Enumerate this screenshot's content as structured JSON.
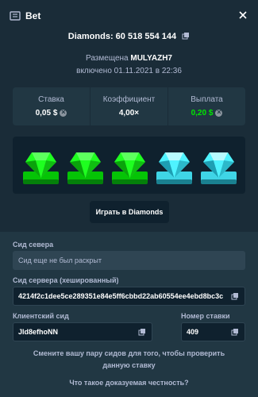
{
  "header": {
    "title": "Bet",
    "icon": "bet-ticket-icon",
    "close_icon": "close-icon"
  },
  "game": {
    "label": "Diamonds: 60 518 554 144",
    "placed_label": "Размещена",
    "user": "MULYAZH7",
    "date": "включено 01.11.2021 в 22:36"
  },
  "stats": {
    "bet_label": "Ставка",
    "bet_value": "0,05 $",
    "multiplier_label": "Коэффициент",
    "multiplier_value": "4,00×",
    "payout_label": "Выплата",
    "payout_value": "0,20 $",
    "payout_color": "#00e701"
  },
  "board": {
    "gems": [
      "green",
      "green",
      "green",
      "cyan",
      "cyan"
    ]
  },
  "play_button": "Играть в Diamonds",
  "seeds": {
    "server_seed_label": "Сид севера",
    "server_seed_placeholder": "Сид еще не был раскрыт",
    "server_hash_label": "Сид сервера (хешированный)",
    "server_hash_value": "4214f2c1dee5ce289351e84e5ff6cbbd22ab60554ee4ebd8bc3c",
    "client_seed_label": "Клиентский сид",
    "client_seed_value": "Jld8efhoNN",
    "nonce_label": "Номер ставки",
    "nonce_value": "409"
  },
  "footer": {
    "note": "Смените вашу пару сидов для того, чтобы проверить данную ставку",
    "fairness_link": "Что такое доказуемая честность?"
  },
  "colors": {
    "background": "#1a2c38",
    "panel": "#213743",
    "input": "#0f212e",
    "accent_green": "#00e701",
    "gem_green": "#1fff20",
    "gem_cyan": "#4ff3ff"
  }
}
